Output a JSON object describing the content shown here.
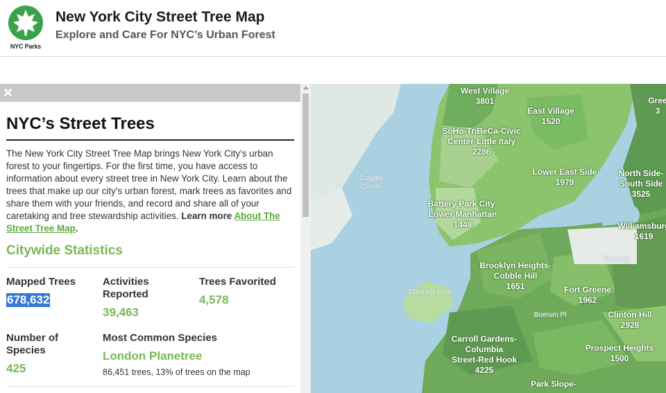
{
  "header": {
    "logo_text": "NYC Parks",
    "title": "New York City Street Tree Map",
    "subtitle": "Explore and Care For NYC’s Urban Forest"
  },
  "panel": {
    "close_icon": "close-icon",
    "heading": "NYC’s Street Trees",
    "intro_text": "The New York City Street Tree Map brings New York City’s urban forest to your fingertips. For the first time, you have access to information about every street tree in New York City. Learn about the trees that make up our city’s urban forest, mark trees as favorites and share them with your friends, and record and share all of your caretaking and tree stewardship activities. ",
    "learn_more_prefix": "Learn more ",
    "learn_more_link": "About The Street Tree Map",
    "learn_more_suffix": ".",
    "stats_heading": "Citywide Statistics",
    "stats": {
      "mapped_trees_label": "Mapped Trees",
      "mapped_trees_value": "678,632",
      "activities_label": "Activities Reported",
      "activities_value": "39,463",
      "favorited_label": "Trees Favorited",
      "favorited_value": "4,578",
      "species_count_label": "Number of Species",
      "species_count_value": "425",
      "common_species_label": "Most Common Species",
      "common_species_value": "London Planetree",
      "common_species_detail": "86,451 trees, 13% of trees on the map"
    }
  },
  "map": {
    "neighborhoods": [
      {
        "name": "West Village",
        "count": "3801"
      },
      {
        "name": "East Village",
        "count": "1520"
      },
      {
        "name": "SoHo-TriBeCa-Civic Center-Little Italy",
        "count": "2286"
      },
      {
        "name": "Lower East Side",
        "count": "1979"
      },
      {
        "name": "North Side-South Side",
        "count": "3525"
      },
      {
        "name": "Battery Park City-Lower Manhattan",
        "count": "1448"
      },
      {
        "name": "Williamsburg",
        "count": "1619"
      },
      {
        "name": "Brooklyn Heights-Cobble Hill",
        "count": "1651"
      },
      {
        "name": "Fort Greene",
        "count": "1962"
      },
      {
        "name": "Clinton Hill",
        "count": "2928"
      },
      {
        "name": "Carroll Gardens-Columbia Street-Red Hook",
        "count": "4225"
      },
      {
        "name": "Prospect Heights",
        "count": "1500"
      },
      {
        "name": "Park Slope-",
        "count": ""
      },
      {
        "name": "Gree",
        "count": "3"
      }
    ],
    "minor_labels": [
      "Colgate Center",
      "Colonels Row",
      "Flushing",
      "Boerum Pl"
    ],
    "colors": {
      "water": "#a9d1e1",
      "land_light": "#b8dba0",
      "land_mid": "#8cc46e",
      "land_dark": "#5f9a52"
    }
  }
}
